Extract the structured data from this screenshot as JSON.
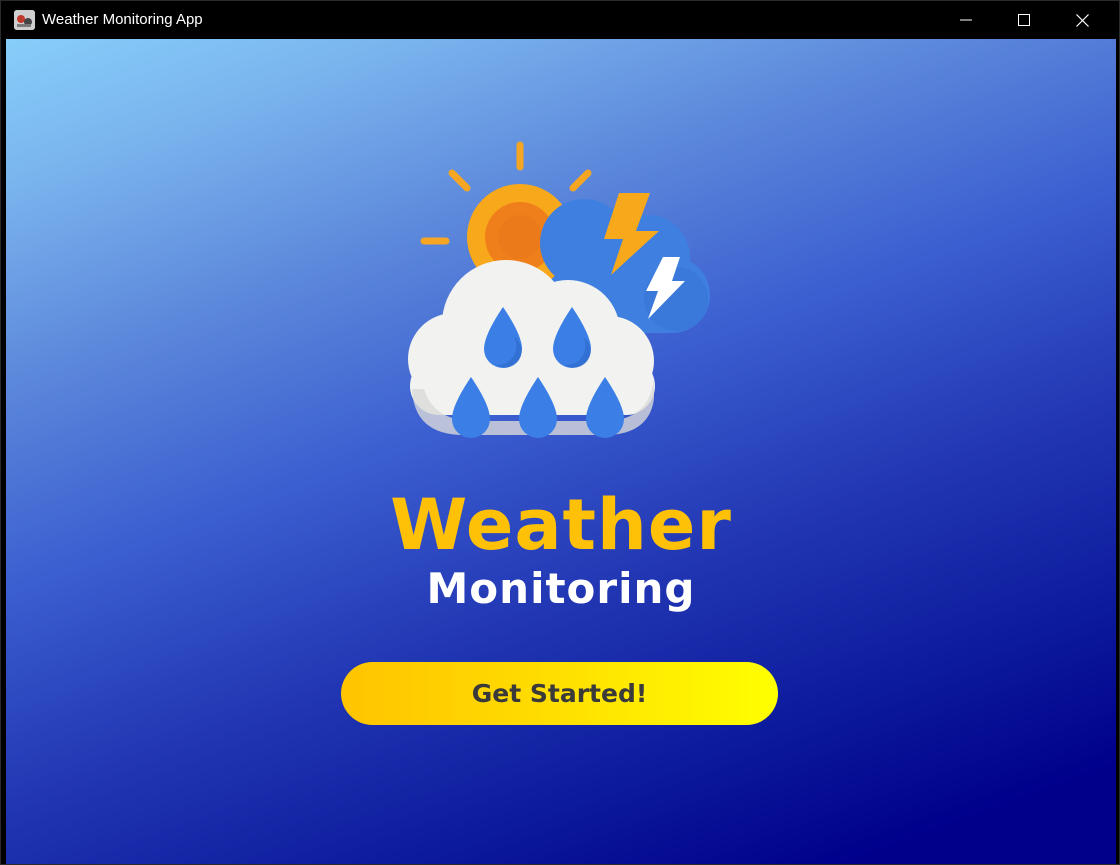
{
  "window": {
    "title": "Weather Monitoring App"
  },
  "icons": {
    "app": "app-icon",
    "minimize": "minimize-icon",
    "maximize": "maximize-icon",
    "close": "close-icon",
    "logo": "weather-storm-rain-icon"
  },
  "main": {
    "title": "Weather",
    "subtitle": "Monitoring",
    "cta_label": "Get Started!"
  },
  "colors": {
    "title": "#ffc107",
    "subtitle": "#ffffff",
    "gradient_start": "#87cefa",
    "gradient_end": "#00008b",
    "button_start": "#ffc400",
    "button_end": "#ffff00",
    "button_text": "#3a3a3a"
  }
}
